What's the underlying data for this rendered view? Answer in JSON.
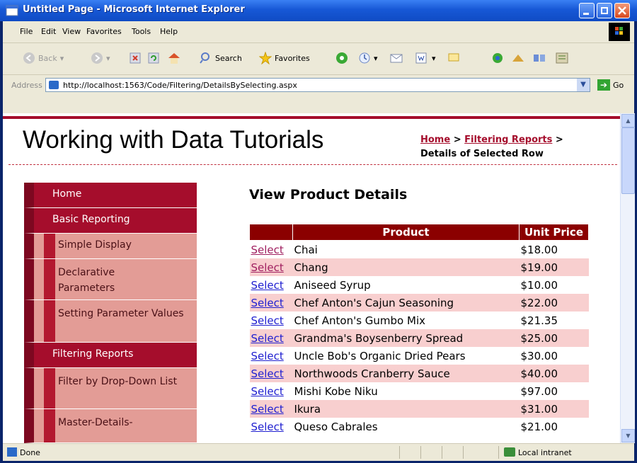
{
  "window": {
    "title": "Untitled Page - Microsoft Internet Explorer"
  },
  "menubar": {
    "items": [
      "File",
      "Edit",
      "View",
      "Favorites",
      "Tools",
      "Help"
    ]
  },
  "toolbar": {
    "back_label": "Back",
    "search_label": "Search",
    "favorites_label": "Favorites"
  },
  "addressbar": {
    "label": "Address",
    "url": "http://localhost:1563/Code/Filtering/DetailsBySelecting.aspx",
    "go_label": "Go"
  },
  "page": {
    "site_title": "Working with Data Tutorials",
    "breadcrumb": {
      "home": "Home",
      "sep1": ">",
      "section": "Filtering Reports",
      "sep2": ">",
      "current": "Details of Selected Row"
    },
    "heading": "View Product Details",
    "menu": [
      {
        "label": "Home",
        "level": "top"
      },
      {
        "label": "Basic Reporting",
        "level": "top"
      },
      {
        "label": "Simple Display",
        "level": "sub"
      },
      {
        "label": "Declarative Parameters",
        "level": "sub"
      },
      {
        "label": "Setting Parameter Values",
        "level": "sub"
      },
      {
        "label": "Filtering Reports",
        "level": "top"
      },
      {
        "label": "Filter by Drop-Down List",
        "level": "sub"
      },
      {
        "label": "Master-Details-",
        "level": "sub"
      }
    ],
    "grid": {
      "headers": [
        "",
        "Product",
        "Unit Price"
      ],
      "select_label": "Select",
      "rows": [
        {
          "product": "Chai",
          "price": "$18.00"
        },
        {
          "product": "Chang",
          "price": "$19.00"
        },
        {
          "product": "Aniseed Syrup",
          "price": "$10.00"
        },
        {
          "product": "Chef Anton's Cajun Seasoning",
          "price": "$22.00"
        },
        {
          "product": "Chef Anton's Gumbo Mix",
          "price": "$21.35"
        },
        {
          "product": "Grandma's Boysenberry Spread",
          "price": "$25.00"
        },
        {
          "product": "Uncle Bob's Organic Dried Pears",
          "price": "$30.00"
        },
        {
          "product": "Northwoods Cranberry Sauce",
          "price": "$40.00"
        },
        {
          "product": "Mishi Kobe Niku",
          "price": "$97.00"
        },
        {
          "product": "Ikura",
          "price": "$31.00"
        },
        {
          "product": "Queso Cabrales",
          "price": "$21.00"
        }
      ]
    }
  },
  "statusbar": {
    "status": "Done",
    "zone": "Local intranet"
  }
}
